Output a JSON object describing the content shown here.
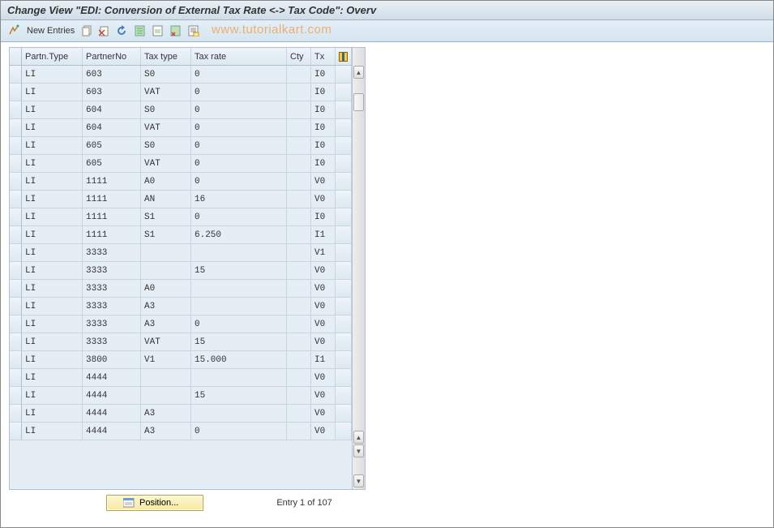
{
  "title": "Change View \"EDI: Conversion of External Tax Rate <-> Tax Code\": Overv",
  "watermark": "www.tutorialkart.com",
  "toolbar": {
    "new_entries": "New Entries"
  },
  "columns": {
    "ptype": "Partn.Type",
    "pno": "PartnerNo",
    "ttype": "Tax type",
    "trate": "Tax rate",
    "cty": "Cty",
    "tx": "Tx"
  },
  "rows": [
    {
      "ptype": "LI",
      "pno": "603",
      "ttype": "S0",
      "trate": "0",
      "cty": "",
      "tx": "I0"
    },
    {
      "ptype": "LI",
      "pno": "603",
      "ttype": "VAT",
      "trate": "0",
      "cty": "",
      "tx": "I0"
    },
    {
      "ptype": "LI",
      "pno": "604",
      "ttype": "S0",
      "trate": "0",
      "cty": "",
      "tx": "I0"
    },
    {
      "ptype": "LI",
      "pno": "604",
      "ttype": "VAT",
      "trate": "0",
      "cty": "",
      "tx": "I0"
    },
    {
      "ptype": "LI",
      "pno": "605",
      "ttype": "S0",
      "trate": "0",
      "cty": "",
      "tx": "I0"
    },
    {
      "ptype": "LI",
      "pno": "605",
      "ttype": "VAT",
      "trate": "0",
      "cty": "",
      "tx": "I0"
    },
    {
      "ptype": "LI",
      "pno": "1111",
      "ttype": "A0",
      "trate": "0",
      "cty": "",
      "tx": "V0"
    },
    {
      "ptype": "LI",
      "pno": "1111",
      "ttype": "AN",
      "trate": "16",
      "cty": "",
      "tx": "V0"
    },
    {
      "ptype": "LI",
      "pno": "1111",
      "ttype": "S1",
      "trate": "0",
      "cty": "",
      "tx": "I0"
    },
    {
      "ptype": "LI",
      "pno": "1111",
      "ttype": "S1",
      "trate": "6.250",
      "cty": "",
      "tx": "I1"
    },
    {
      "ptype": "LI",
      "pno": "3333",
      "ttype": "",
      "trate": "",
      "cty": "",
      "tx": "V1"
    },
    {
      "ptype": "LI",
      "pno": "3333",
      "ttype": "",
      "trate": "15",
      "cty": "",
      "tx": "V0"
    },
    {
      "ptype": "LI",
      "pno": "3333",
      "ttype": "A0",
      "trate": "",
      "cty": "",
      "tx": "V0"
    },
    {
      "ptype": "LI",
      "pno": "3333",
      "ttype": "A3",
      "trate": "",
      "cty": "",
      "tx": "V0"
    },
    {
      "ptype": "LI",
      "pno": "3333",
      "ttype": "A3",
      "trate": "0",
      "cty": "",
      "tx": "V0"
    },
    {
      "ptype": "LI",
      "pno": "3333",
      "ttype": "VAT",
      "trate": "15",
      "cty": "",
      "tx": "V0"
    },
    {
      "ptype": "LI",
      "pno": "3800",
      "ttype": "V1",
      "trate": "15.000",
      "cty": "",
      "tx": "I1"
    },
    {
      "ptype": "LI",
      "pno": "4444",
      "ttype": "",
      "trate": "",
      "cty": "",
      "tx": "V0"
    },
    {
      "ptype": "LI",
      "pno": "4444",
      "ttype": "",
      "trate": "15",
      "cty": "",
      "tx": "V0"
    },
    {
      "ptype": "LI",
      "pno": "4444",
      "ttype": "A3",
      "trate": "",
      "cty": "",
      "tx": "V0"
    },
    {
      "ptype": "LI",
      "pno": "4444",
      "ttype": "A3",
      "trate": "0",
      "cty": "",
      "tx": "V0"
    }
  ],
  "footer": {
    "position_btn": "Position...",
    "entry_label": "Entry 1 of 107"
  }
}
